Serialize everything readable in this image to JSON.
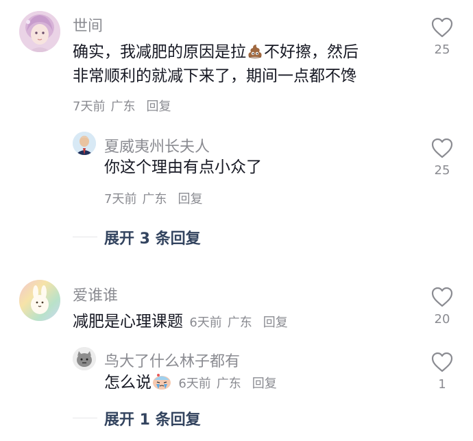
{
  "comments": [
    {
      "user": "世间",
      "text_line1_a": "确实，我减肥的原因是拉",
      "emoji_icon": "poop-emoji",
      "text_line1_b": "不好擦，然后",
      "text_line2": "非常顺利的就减下来了，期间一点都不馋",
      "time": "7天前",
      "location": "广东",
      "reply_label": "回复",
      "likes": "25",
      "replies": [
        {
          "user": "夏威夷州长夫人",
          "text": "你这个理由有点小众了",
          "time": "7天前",
          "location": "广东",
          "reply_label": "回复",
          "likes": "25"
        }
      ],
      "expand_label": "展开 3 条回复"
    },
    {
      "user": "爱谁谁",
      "text": "减肥是心理课题",
      "time": "6天前",
      "location": "广东",
      "reply_label": "回复",
      "likes": "20",
      "replies": [
        {
          "user": "鸟大了什么林子都有",
          "text": "怎么说",
          "emoji_icon": "sweating-face-emoji",
          "time": "6天前",
          "location": "广东",
          "reply_label": "回复",
          "likes": "1"
        }
      ],
      "expand_label": "展开 1 条回复"
    }
  ],
  "colors": {
    "primary_text": "#161823",
    "secondary_text": "#8a8b91",
    "expand_text": "#33445f",
    "icon_stroke": "#8a8b91"
  }
}
